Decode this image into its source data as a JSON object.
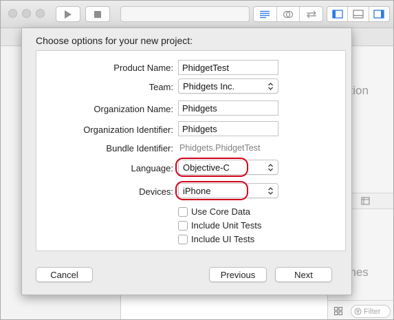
{
  "sheet": {
    "title": "Choose options for your new project:"
  },
  "form": {
    "product_name": {
      "label": "Product Name:",
      "value": "PhidgetTest"
    },
    "team": {
      "label": "Team:",
      "value": "Phidgets Inc."
    },
    "organization_name": {
      "label": "Organization Name:",
      "value": "Phidgets"
    },
    "organization_identifier": {
      "label": "Organization Identifier:",
      "value": "Phidgets"
    },
    "bundle_identifier": {
      "label": "Bundle Identifier:",
      "value": "Phidgets.PhidgetTest"
    },
    "language": {
      "label": "Language:",
      "value": "Objective-C",
      "highlighted": true
    },
    "devices": {
      "label": "Devices:",
      "value": "iPhone",
      "highlighted": true
    },
    "checkboxes": [
      {
        "label": "Use Core Data",
        "checked": false
      },
      {
        "label": "Include Unit Tests",
        "checked": false
      },
      {
        "label": "Include UI Tests",
        "checked": false
      }
    ]
  },
  "buttons": {
    "cancel": "Cancel",
    "previous": "Previous",
    "next": "Next"
  },
  "inspector": {
    "no_selection_fragment": "ction",
    "no_matches_fragment": "ches",
    "filter_placeholder": "Filter"
  },
  "colors": {
    "highlight": "#d4001a",
    "accent": "#1a73e8"
  },
  "icons": {
    "run": "play-icon",
    "stop": "stop-icon",
    "standard_editor": "standard-editor-icon",
    "assistant_editor": "assistant-editor-icon",
    "version_editor": "version-editor-icon",
    "navigator_toggle": "left-panel-icon",
    "debug_toggle": "bottom-panel-icon",
    "utilities_toggle": "right-panel-icon",
    "popup_stepper": "up-down-chevron-icon"
  }
}
